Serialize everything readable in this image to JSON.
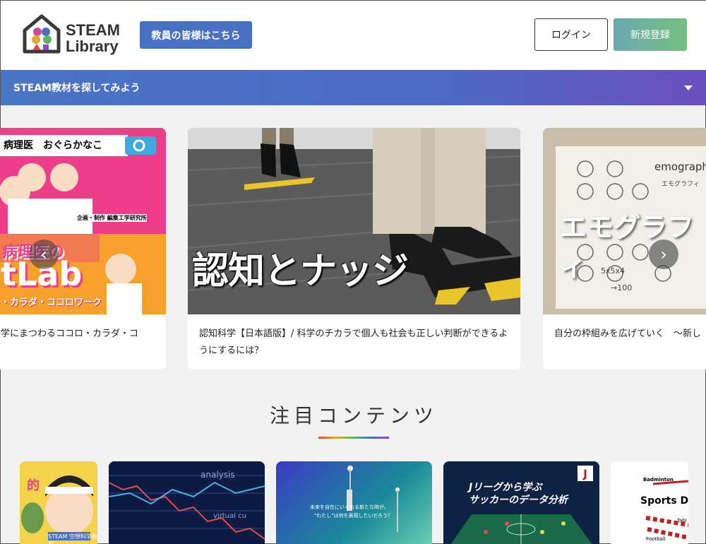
{
  "header": {
    "logo_line1": "STEAM",
    "logo_line2": "Library",
    "teacher_button": "教員の皆様はこちら",
    "login_button": "ログイン",
    "signup_button": "新規登録"
  },
  "explore": {
    "label": "STEAM教材を探してみよう"
  },
  "carousel": {
    "cards": [
      {
        "caption": "学にまつわるココロ・カラダ・コ",
        "image_texts": [
          "病理医　おぐらかなこ",
          "病理医の",
          "tLab",
          "・カラダ・ココロワーク",
          "企画・制作 編集工学研究所"
        ]
      },
      {
        "caption": "認知科学【日本語版】/ 科学のチカラで個人も社会も正しい判断ができるようにするには？",
        "image_texts": [
          "認知とナッジ"
        ]
      },
      {
        "caption": "自分の枠組みを広げていく　〜新し",
        "image_texts": [
          "エモグラフィ",
          "emography",
          "エモグラフィ",
          "5x5x4",
          "→100"
        ]
      }
    ],
    "prev_icon": "chevron-left-icon",
    "next_icon": "chevron-right-icon"
  },
  "featured": {
    "title": "注目コンテンツ",
    "thumbs": [
      {
        "image_texts": [
          "的",
          "STEAM 空想科学教室"
        ]
      },
      {
        "image_texts": [
          "analysis",
          "virtual cu"
        ]
      },
      {
        "image_texts": [
          "未来を自在にいくれる新たな時が、",
          "\"わたし\"は何を表現したいだろう？"
        ]
      },
      {
        "image_texts": [
          "Jリーグから学ぶ",
          "サッカーのデータ分析"
        ]
      },
      {
        "image_texts": [
          "Badminton",
          "Sports Dat",
          "Football",
          "Tabl"
        ]
      }
    ]
  }
}
